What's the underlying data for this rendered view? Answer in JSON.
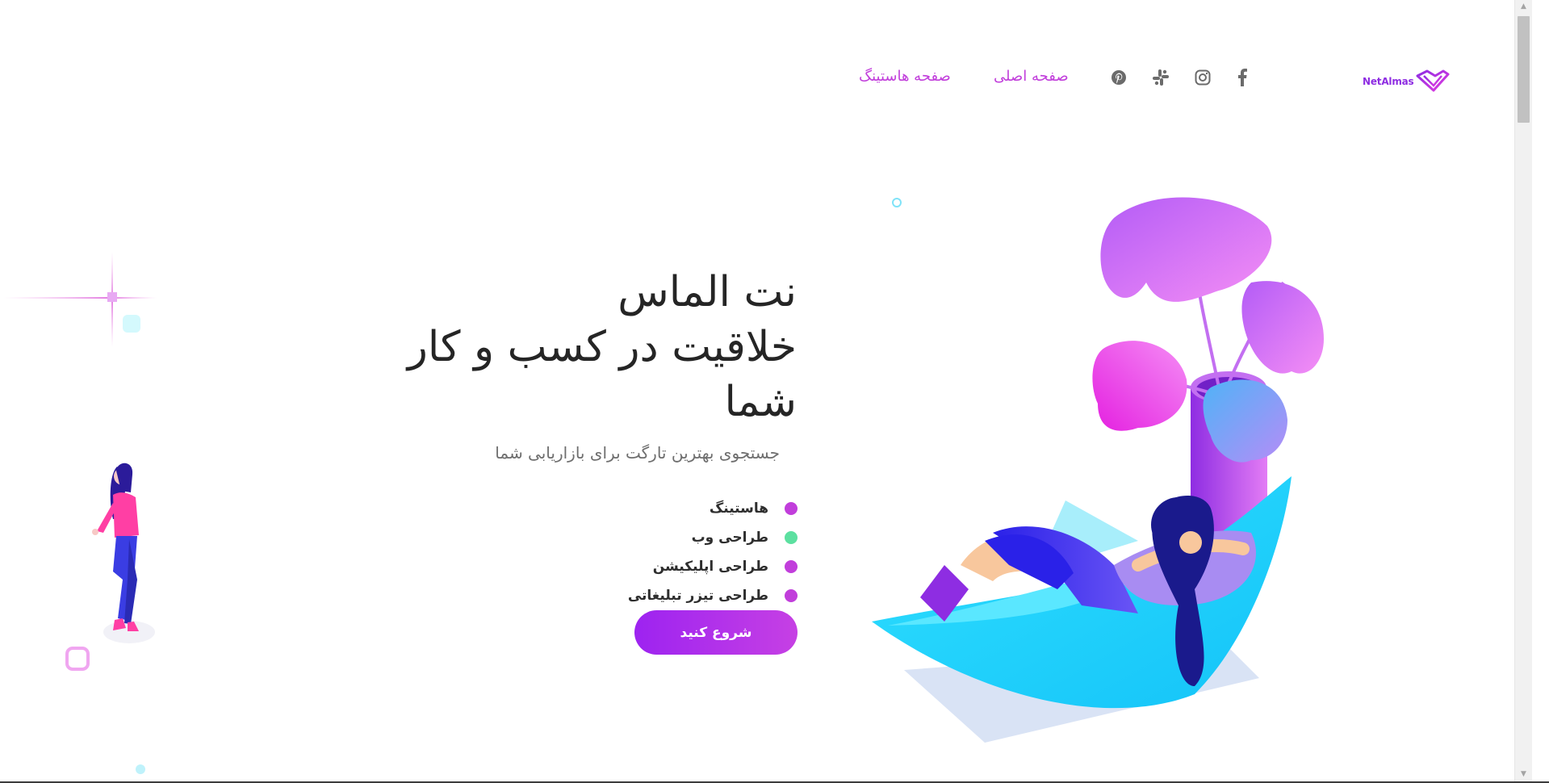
{
  "brand": {
    "logo_text": "NetAlmas",
    "accent": "#b23be0"
  },
  "nav": {
    "links": [
      "صفحه اصلی",
      "صفحه هاستینگ"
    ],
    "social": [
      "facebook-icon",
      "instagram-icon",
      "slack-icon",
      "pinterest-icon"
    ]
  },
  "hero": {
    "title_lines": [
      "نت الماس",
      "خلاقیت در کسب و کار",
      "شما"
    ],
    "subtitle": "جستجوی بهترین تارگت برای بازاریابی شما",
    "features": [
      {
        "label": "هاستینگ",
        "color": "#c13edb"
      },
      {
        "label": "طراحی وب",
        "color": "#5ce0a0"
      },
      {
        "label": "طراحی اپلیکیشن",
        "color": "#c13edb"
      },
      {
        "label": "طراحی تیزر تبلیغاتی",
        "color": "#c13edb"
      }
    ],
    "cta_label": "شروع کنید"
  },
  "colors": {
    "cyan": "#1cd6fb",
    "purple": "#8e2de2",
    "pink": "#f35ce8",
    "navy": "#1a1a8c"
  }
}
